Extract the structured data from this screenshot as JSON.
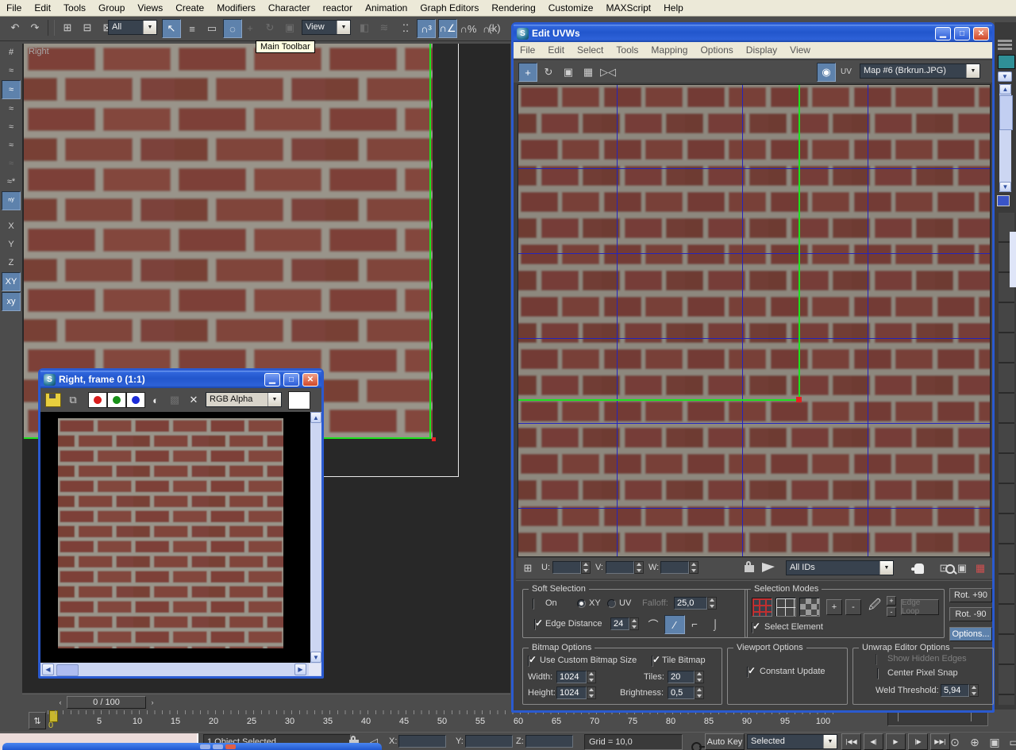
{
  "colors": {
    "brick": "#7e463e",
    "mortar": "#99948a",
    "selection_green": "#1ee11e",
    "grid_blue": "#2424bc",
    "vertex_red": "#e42222",
    "active_button": "#5e82ac",
    "titlebar_blue": "#2256cc",
    "tooltip_bg": "#ffffe1"
  },
  "menubar": {
    "items": [
      "File",
      "Edit",
      "Tools",
      "Group",
      "Views",
      "Create",
      "Modifiers",
      "Character",
      "reactor",
      "Animation",
      "Graph Editors",
      "Rendering",
      "Customize",
      "MAXScript",
      "Help"
    ]
  },
  "toolbar": {
    "tooltip": "Main Toolbar",
    "selection_filter": "All",
    "coord_system": "View",
    "seg1": [
      {
        "name": "undo-icon",
        "glyph": "↶"
      },
      {
        "name": "redo-icon",
        "glyph": "↷"
      },
      {
        "name": "toolbar-separator",
        "glyph": "",
        "cls": "sep"
      },
      {
        "name": "select-and-link-icon",
        "glyph": "⊞"
      },
      {
        "name": "unlink-selection-icon",
        "glyph": "⊟"
      },
      {
        "name": "bind-to-spacewarp-icon",
        "glyph": "⊠"
      }
    ],
    "seg2": [
      {
        "name": "select-object-icon",
        "glyph": "↖",
        "cls": "active"
      },
      {
        "name": "select-by-name-icon",
        "glyph": "≡"
      },
      {
        "name": "rectangular-selection-region-icon",
        "glyph": "▭"
      },
      {
        "name": "window-crossing-toggle-icon",
        "glyph": "◌",
        "cls": "active"
      }
    ],
    "seg3": [
      {
        "name": "select-and-move-icon",
        "glyph": "+",
        "cls": "disabled"
      },
      {
        "name": "select-and-rotate-icon",
        "glyph": "↻",
        "cls": "disabled"
      },
      {
        "name": "select-and-scale-icon",
        "glyph": "▣",
        "cls": "disabled"
      }
    ],
    "seg4": [
      {
        "name": "mirror-icon",
        "glyph": "◧",
        "cls": "disabled"
      },
      {
        "name": "align-icon",
        "glyph": "≋",
        "cls": "disabled"
      }
    ],
    "seg5": [
      {
        "name": "snaps-use-axis-constraints-icon",
        "glyph": "⁚⁚"
      },
      {
        "name": "snap-toggle-3d-icon",
        "glyph": "∩³",
        "cls": "active"
      },
      {
        "name": "angle-snap-icon",
        "glyph": "∩∠",
        "cls": "active"
      },
      {
        "name": "percent-snap-icon",
        "glyph": "∩%"
      },
      {
        "name": "spinner-snap-icon",
        "glyph": "∩▫"
      }
    ],
    "seg6": [
      {
        "name": "keyboard-shortcut-override-icon",
        "glyph": "(k)"
      }
    ]
  },
  "lefttoolbar": {
    "icons": [
      {
        "name": "uvw-snap-grid-icon",
        "glyph": "#"
      },
      {
        "name": "snap-standard-icon",
        "glyph": "≈"
      },
      {
        "name": "snap-vertex-icon",
        "glyph": "≈",
        "cls": "active"
      },
      {
        "name": "snap-edge-icon",
        "glyph": "≈"
      },
      {
        "name": "snap-midpoint-icon",
        "glyph": "≈"
      },
      {
        "name": "snap-face-icon",
        "glyph": "≈"
      },
      {
        "name": "snap-pivot-icon",
        "glyph": "≈",
        "cls": "disabled"
      },
      {
        "name": "snap-all-icon",
        "glyph": "≈*"
      },
      {
        "name": "snap-xy-icon",
        "glyph": "ⁿʸ",
        "cls": "active"
      },
      {
        "name": "axis-x-button",
        "glyph": "X",
        "cls": "gap"
      },
      {
        "name": "axis-y-button",
        "glyph": "Y"
      },
      {
        "name": "axis-z-button",
        "glyph": "Z"
      },
      {
        "name": "axis-xy-button",
        "glyph": "XY",
        "cls": "active"
      },
      {
        "name": "axis-xy2-button",
        "glyph": "xy",
        "cls": "active"
      }
    ]
  },
  "viewport": {
    "label": "Right"
  },
  "render": {
    "title": "Right, frame 0 (1:1)",
    "channel_dropdown": "RGB Alpha"
  },
  "uvw": {
    "title": "Edit UVWs",
    "menu": [
      "File",
      "Edit",
      "Select",
      "Tools",
      "Mapping",
      "Options",
      "Display",
      "View"
    ],
    "tools": [
      {
        "name": "move-uv-icon",
        "glyph": "+",
        "cls": "active"
      },
      {
        "name": "rotate-uv-icon",
        "glyph": "↻"
      },
      {
        "name": "scale-uv-icon",
        "glyph": "▣"
      },
      {
        "name": "freeform-mode-icon",
        "glyph": "▦"
      },
      {
        "name": "mirror-uv-icon",
        "glyph": "▷◁"
      }
    ],
    "show_map_label": "UV",
    "map_dropdown": "Map #6 (Brkrun.JPG)",
    "bottom": {
      "u": "U:",
      "v": "V:",
      "w": "W:",
      "ids": "All IDs"
    },
    "soft": {
      "title": "Soft Selection",
      "on": "On",
      "xy": "XY",
      "uv": "UV",
      "falloff": "Falloff:",
      "falloff_value": "25,0",
      "edge_distance": "Edge Distance",
      "edge_value": "24"
    },
    "modes": {
      "title": "Selection Modes",
      "plus": "+",
      "minus": "-",
      "edge_loop": "Edge Loop",
      "select_element": "Select Element"
    },
    "side": {
      "rot_plus": "Rot. +90",
      "rot_minus": "Rot. -90",
      "options": "Options..."
    },
    "bitmap": {
      "title": "Bitmap Options",
      "use_custom": "Use Custom Bitmap Size",
      "tile": "Tile Bitmap",
      "width": "Width:",
      "width_value": "1024",
      "tiles": "Tiles:",
      "tiles_value": "20",
      "height": "Height:",
      "height_value": "1024",
      "brightness": "Brightness:",
      "brightness_value": "0,5"
    },
    "vopts": {
      "title": "Viewport Options",
      "constant_update": "Constant Update"
    },
    "unwrap": {
      "title": "Unwrap Editor Options",
      "show_hidden": "Show Hidden Edges",
      "center_pixel": "Center Pixel Snap",
      "weld": "Weld Threshold:",
      "weld_value": "5,94"
    }
  },
  "timeline": {
    "frame": "0 / 100",
    "zero": "0",
    "ticks": [
      "5",
      "10",
      "15",
      "20",
      "25",
      "30",
      "35",
      "40",
      "45",
      "50",
      "55",
      "60",
      "65",
      "70",
      "75",
      "80",
      "85",
      "90",
      "95",
      "100"
    ]
  },
  "status": {
    "text": "1 Object Selected",
    "x": "X:",
    "y": "Y:",
    "z": "Z:",
    "grid": "Grid = 10,0",
    "auto_key": "Auto Key",
    "selected": "Selected",
    "playback": [
      {
        "name": "go-to-start-icon",
        "glyph": "|◀◀"
      },
      {
        "name": "previous-frame-icon",
        "glyph": "◀|"
      },
      {
        "name": "play-animation-icon",
        "glyph": "▶"
      },
      {
        "name": "next-frame-icon",
        "glyph": "|▶"
      },
      {
        "name": "go-to-end-icon",
        "glyph": "▶▶|"
      }
    ],
    "viewtools": [
      {
        "name": "zoom-icon",
        "glyph": "⊙"
      },
      {
        "name": "zoom-all-icon",
        "glyph": "⊕"
      },
      {
        "name": "zoom-extents-icon",
        "glyph": "▣"
      },
      {
        "name": "zoom-region-icon",
        "glyph": "▭"
      }
    ]
  }
}
